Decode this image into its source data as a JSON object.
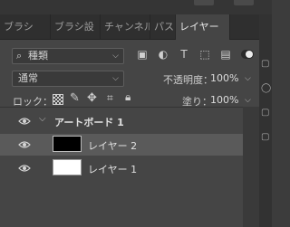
{
  "tabs": [
    {
      "label": "ブラシ"
    },
    {
      "label": "ブラシ設"
    },
    {
      "label": "チャンネル"
    },
    {
      "label": "パス"
    },
    {
      "label": "レイヤー"
    }
  ],
  "filter": {
    "kind_label": "種類",
    "icons": [
      "image-filter-icon",
      "adjustment-filter-icon",
      "type-filter-icon",
      "shape-filter-icon",
      "smart-object-filter-icon"
    ]
  },
  "blend": {
    "mode": "通常",
    "opacity_label": "不透明度：",
    "opacity_value": "100%"
  },
  "lock": {
    "label": "ロック：",
    "fill_label": "塗り：",
    "fill_value": "100%"
  },
  "layers": [
    {
      "name": "アートボード 1",
      "type": "artboard",
      "expanded": true
    },
    {
      "name": "レイヤー 2",
      "thumb_color": "#000000",
      "selected": true
    },
    {
      "name": "レイヤー 1",
      "thumb_color": "#ffffff",
      "selected": false
    }
  ],
  "colors": {
    "panel_bg": "#454545",
    "tabbar_bg": "#2f2f2f",
    "selected_row": "#5a5a5a",
    "text": "#d4d4d4"
  }
}
